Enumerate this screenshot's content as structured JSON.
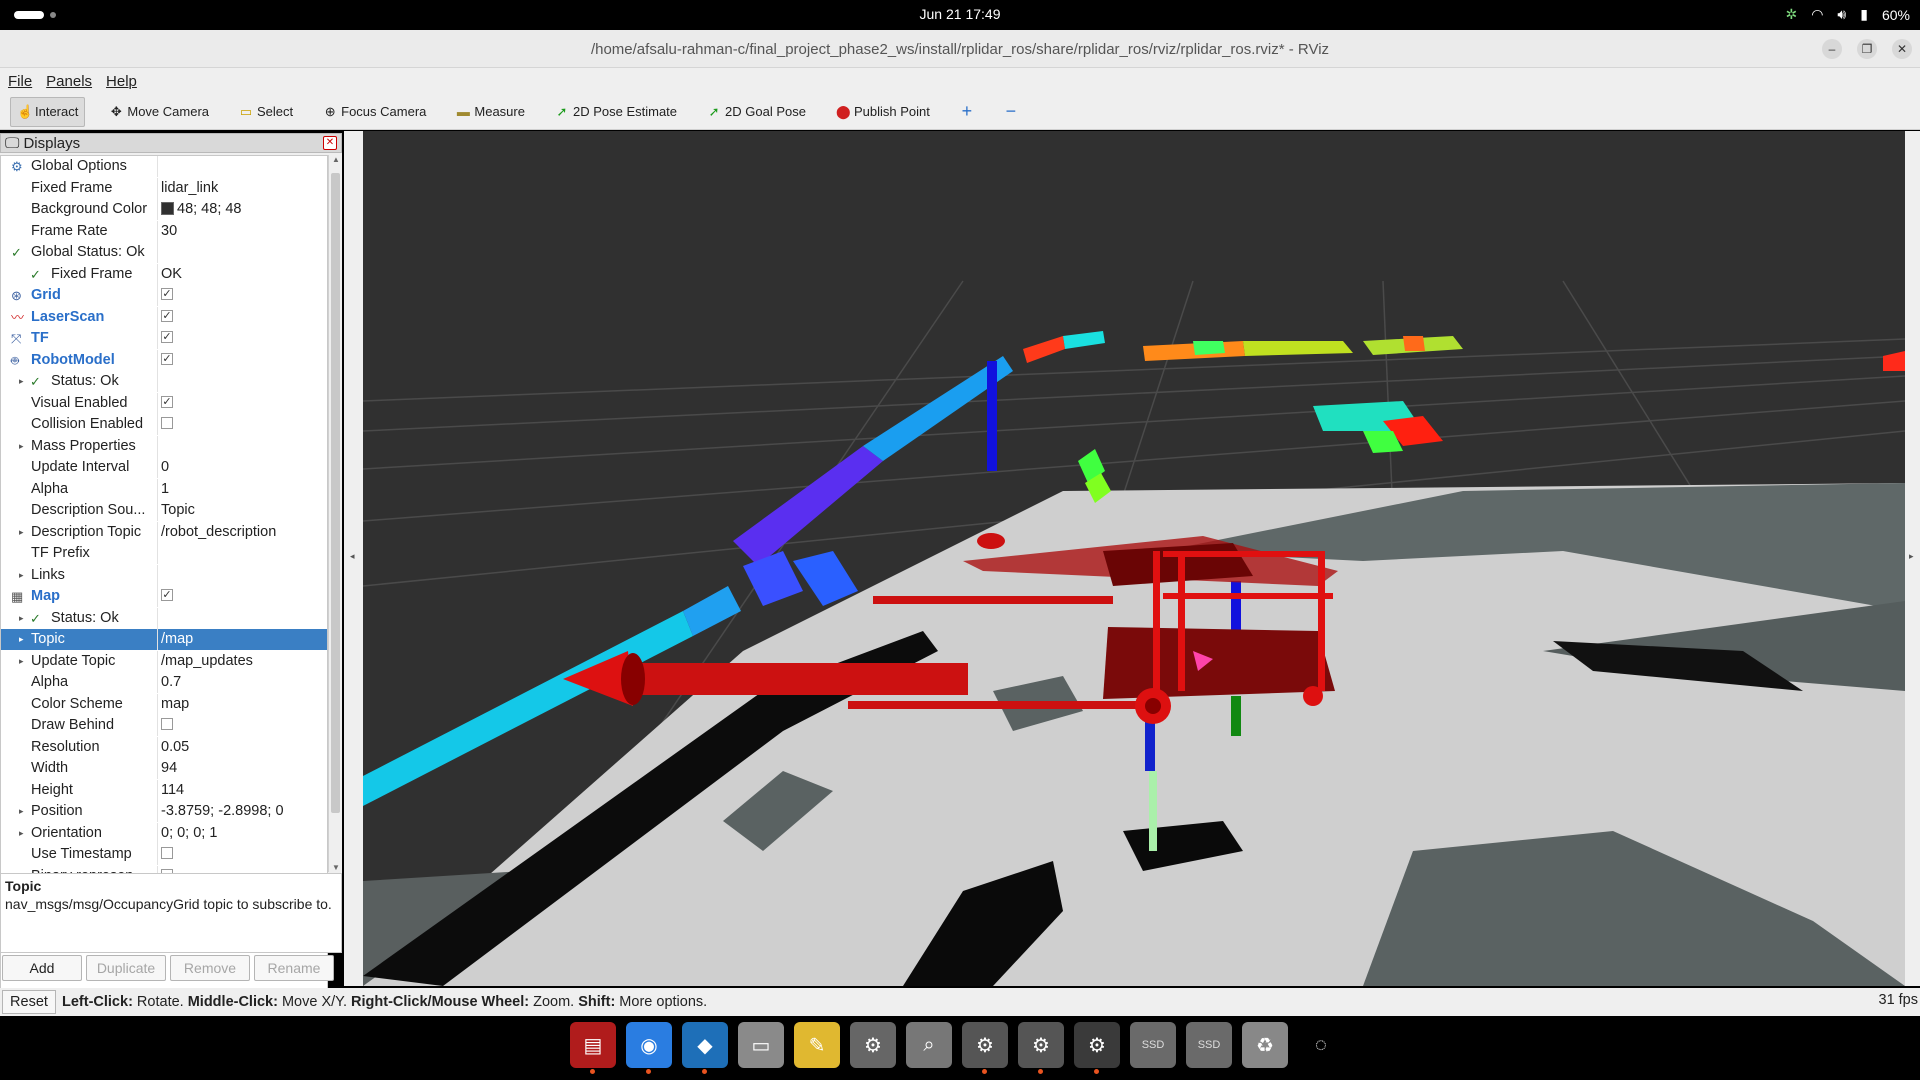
{
  "topbar": {
    "clock": "Jun 21  17:49",
    "battery": "60%"
  },
  "window": {
    "title": "/home/afsalu-rahman-c/final_project_phase2_ws/install/rplidar_ros/share/rplidar_ros/rviz/rplidar_ros.rviz* - RViz"
  },
  "menu": {
    "file": "File",
    "panels": "Panels",
    "help": "Help"
  },
  "toolbar": {
    "tools": [
      {
        "label": "Interact",
        "icon": "pointer-icon"
      },
      {
        "label": "Move Camera",
        "icon": "move-icon"
      },
      {
        "label": "Select",
        "icon": "select-icon"
      },
      {
        "label": "Focus Camera",
        "icon": "focus-icon"
      },
      {
        "label": "Measure",
        "icon": "ruler-icon"
      },
      {
        "label": "2D Pose Estimate",
        "icon": "arrow-icon"
      },
      {
        "label": "2D Goal Pose",
        "icon": "arrow-icon"
      },
      {
        "label": "Publish Point",
        "icon": "pin-icon"
      }
    ],
    "plus": "+",
    "minus": "−"
  },
  "displays": {
    "title": "Displays",
    "rows": [
      {
        "label": "Global Options",
        "value": "",
        "indent": 0,
        "arrow": "",
        "icon": "gear",
        "kind": "plain"
      },
      {
        "label": "Fixed Frame",
        "value": "lidar_link",
        "indent": 1,
        "arrow": "",
        "icon": "",
        "kind": "plain"
      },
      {
        "label": "Background Color",
        "value": "48; 48; 48",
        "indent": 1,
        "arrow": "",
        "icon": "",
        "kind": "color"
      },
      {
        "label": "Frame Rate",
        "value": "30",
        "indent": 1,
        "arrow": "",
        "icon": "",
        "kind": "plain"
      },
      {
        "label": "Global Status: Ok",
        "value": "",
        "indent": 0,
        "arrow": "",
        "icon": "check",
        "kind": "plain"
      },
      {
        "label": "Fixed Frame",
        "value": "OK",
        "indent": 1,
        "arrow": "",
        "icon": "check",
        "kind": "plain"
      },
      {
        "label": "Grid",
        "value": "",
        "indent": 0,
        "arrow": "",
        "icon": "grid",
        "kind": "display",
        "checked": true
      },
      {
        "label": "LaserScan",
        "value": "",
        "indent": 0,
        "arrow": "",
        "icon": "laser",
        "kind": "display",
        "checked": true
      },
      {
        "label": "TF",
        "value": "",
        "indent": 0,
        "arrow": "",
        "icon": "tf",
        "kind": "display",
        "checked": true
      },
      {
        "label": "RobotModel",
        "value": "",
        "indent": 0,
        "arrow": "",
        "icon": "robot",
        "kind": "display",
        "checked": true
      },
      {
        "label": "Status: Ok",
        "value": "",
        "indent": 1,
        "arrow": "▸",
        "icon": "check",
        "kind": "plain"
      },
      {
        "label": "Visual Enabled",
        "value": "",
        "indent": 1,
        "arrow": "",
        "icon": "",
        "kind": "checkbox",
        "checked": true
      },
      {
        "label": "Collision Enabled",
        "value": "",
        "indent": 1,
        "arrow": "",
        "icon": "",
        "kind": "checkbox",
        "checked": false
      },
      {
        "label": "Mass Properties",
        "value": "",
        "indent": 1,
        "arrow": "▸",
        "icon": "",
        "kind": "plain"
      },
      {
        "label": "Update Interval",
        "value": "0",
        "indent": 1,
        "arrow": "",
        "icon": "",
        "kind": "plain"
      },
      {
        "label": "Alpha",
        "value": "1",
        "indent": 1,
        "arrow": "",
        "icon": "",
        "kind": "plain"
      },
      {
        "label": "Description Sou...",
        "value": "Topic",
        "indent": 1,
        "arrow": "",
        "icon": "",
        "kind": "plain"
      },
      {
        "label": "Description Topic",
        "value": "/robot_description",
        "indent": 1,
        "arrow": "▸",
        "icon": "",
        "kind": "plain"
      },
      {
        "label": "TF Prefix",
        "value": "",
        "indent": 1,
        "arrow": "",
        "icon": "",
        "kind": "plain"
      },
      {
        "label": "Links",
        "value": "",
        "indent": 1,
        "arrow": "▸",
        "icon": "",
        "kind": "plain"
      },
      {
        "label": "Map",
        "value": "",
        "indent": 0,
        "arrow": "",
        "icon": "map",
        "kind": "display",
        "checked": true
      },
      {
        "label": "Status: Ok",
        "value": "",
        "indent": 1,
        "arrow": "▸",
        "icon": "check",
        "kind": "plain"
      },
      {
        "label": "Topic",
        "value": "/map",
        "indent": 1,
        "arrow": "▸",
        "icon": "",
        "kind": "plain",
        "selected": true
      },
      {
        "label": "Update Topic",
        "value": "/map_updates",
        "indent": 1,
        "arrow": "▸",
        "icon": "",
        "kind": "plain"
      },
      {
        "label": "Alpha",
        "value": "0.7",
        "indent": 1,
        "arrow": "",
        "icon": "",
        "kind": "plain"
      },
      {
        "label": "Color Scheme",
        "value": "map",
        "indent": 1,
        "arrow": "",
        "icon": "",
        "kind": "plain"
      },
      {
        "label": "Draw Behind",
        "value": "",
        "indent": 1,
        "arrow": "",
        "icon": "",
        "kind": "checkbox",
        "checked": false
      },
      {
        "label": "Resolution",
        "value": "0.05",
        "indent": 1,
        "arrow": "",
        "icon": "",
        "kind": "plain"
      },
      {
        "label": "Width",
        "value": "94",
        "indent": 1,
        "arrow": "",
        "icon": "",
        "kind": "plain"
      },
      {
        "label": "Height",
        "value": "114",
        "indent": 1,
        "arrow": "",
        "icon": "",
        "kind": "plain"
      },
      {
        "label": "Position",
        "value": "-3.8759; -2.8998; 0",
        "indent": 1,
        "arrow": "▸",
        "icon": "",
        "kind": "plain"
      },
      {
        "label": "Orientation",
        "value": "0; 0; 0; 1",
        "indent": 1,
        "arrow": "▸",
        "icon": "",
        "kind": "plain"
      },
      {
        "label": "Use Timestamp",
        "value": "",
        "indent": 1,
        "arrow": "",
        "icon": "",
        "kind": "checkbox",
        "checked": false
      },
      {
        "label": "Binary represen...",
        "value": "",
        "indent": 1,
        "arrow": "",
        "icon": "",
        "kind": "checkbox",
        "checked": false
      }
    ]
  },
  "description": {
    "title": "Topic",
    "text": "nav_msgs/msg/OccupancyGrid topic to subscribe to."
  },
  "buttons": {
    "add": "Add",
    "duplicate": "Duplicate",
    "remove": "Remove",
    "rename": "Rename"
  },
  "status": {
    "reset": "Reset",
    "hint_parts": [
      {
        "b": "Left-Click:",
        "t": " Rotate. "
      },
      {
        "b": "Middle-Click:",
        "t": " Move X/Y. "
      },
      {
        "b": "Right-Click/Mouse Wheel:",
        "t": " Zoom. "
      },
      {
        "b": "Shift:",
        "t": " More options."
      }
    ],
    "fps": "31 fps"
  },
  "dock": {
    "apps": [
      {
        "name": "terminal-app-icon",
        "color": "#b01c1c",
        "glyph": "▤",
        "running": true
      },
      {
        "name": "chrome-app-icon",
        "color": "#2a7de1",
        "glyph": "◉",
        "running": true
      },
      {
        "name": "vscode-app-icon",
        "color": "#1e6fb8",
        "glyph": "◆",
        "running": true
      },
      {
        "name": "files-app-icon",
        "color": "#8a8a8a",
        "glyph": "▭",
        "running": false
      },
      {
        "name": "text-editor-app-icon",
        "color": "#e0b830",
        "glyph": "✎",
        "running": false
      },
      {
        "name": "settings-app-icon",
        "color": "#666",
        "glyph": "⚙",
        "running": false
      },
      {
        "name": "image-viewer-app-icon",
        "color": "#777",
        "glyph": "⌕",
        "running": false
      },
      {
        "name": "rviz-app-icon",
        "color": "#555",
        "glyph": "⚙",
        "running": true
      },
      {
        "name": "rviz2-app-icon",
        "color": "#555",
        "glyph": "⚙",
        "running": true
      },
      {
        "name": "rviz3-app-icon",
        "color": "#555",
        "glyph": "⚙",
        "running": true,
        "current": true
      },
      {
        "name": "ssd-drive-icon",
        "color": "#6a6a6a",
        "glyph": "SSD",
        "running": false
      },
      {
        "name": "ssd2-drive-icon",
        "color": "#6a6a6a",
        "glyph": "SSD",
        "running": false
      },
      {
        "name": "trash-icon",
        "color": "#888",
        "glyph": "♻",
        "running": false
      },
      {
        "name": "show-apps-icon",
        "color": "#000",
        "glyph": "◌",
        "running": false
      }
    ]
  }
}
